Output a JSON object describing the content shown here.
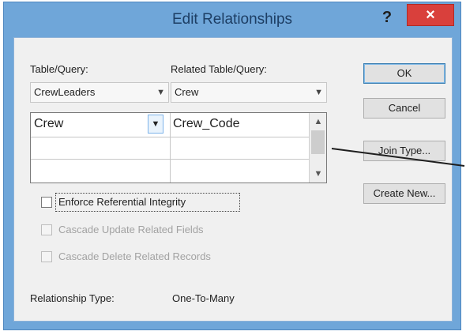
{
  "window": {
    "title": "Edit Relationships",
    "help_label": "?",
    "close_label": "×"
  },
  "labels": {
    "table_query": "Table/Query:",
    "related_table_query": "Related Table/Query:",
    "relationship_type_label": "Relationship Type:",
    "relationship_type_value": "One-To-Many"
  },
  "combos": {
    "table_value": "CrewLeaders",
    "related_value": "Crew"
  },
  "grid": {
    "rows": [
      {
        "left": "Crew",
        "right": "Crew_Code"
      },
      {
        "left": "",
        "right": ""
      },
      {
        "left": "",
        "right": ""
      }
    ]
  },
  "checkboxes": {
    "enforce": "Enforce Referential Integrity",
    "cascade_update": "Cascade Update Related Fields",
    "cascade_delete": "Cascade Delete Related Records"
  },
  "buttons": {
    "ok": "OK",
    "cancel": "Cancel",
    "join_type": "Join Type...",
    "create_new": "Create New..."
  },
  "colors": {
    "title_bar": "#6fa6d9",
    "close_button": "#d9403c",
    "client_bg": "#f0f0f0"
  }
}
